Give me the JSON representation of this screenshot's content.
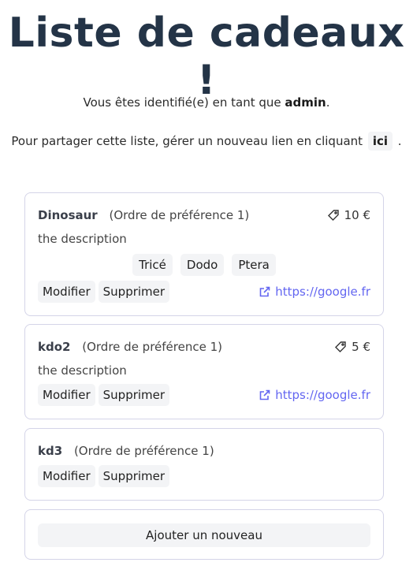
{
  "page": {
    "title": "Liste de cadeaux !",
    "identity_prefix": "Vous êtes identifié(e) en tant que",
    "username": "admin",
    "identity_suffix": ".",
    "share_prefix": "Pour partager cette liste, gérer un nouveau lien en cliquant",
    "share_link": "ici",
    "share_suffix": "."
  },
  "gifts": [
    {
      "name": "Dinosaur",
      "preference": "(Ordre de préférence 1)",
      "price": "10 €",
      "description": "the description",
      "tags": [
        "Tricé",
        "Dodo",
        "Ptera"
      ],
      "edit_label": "Modifier",
      "delete_label": "Supprimer",
      "link": "https://google.fr"
    },
    {
      "name": "kdo2",
      "preference": "(Ordre de préférence 1)",
      "price": "5 €",
      "description": "the description",
      "edit_label": "Modifier",
      "delete_label": "Supprimer",
      "link": "https://google.fr"
    },
    {
      "name": "kd3",
      "preference": "(Ordre de préférence 1)",
      "edit_label": "Modifier",
      "delete_label": "Supprimer"
    }
  ],
  "add_button": "Ajouter un nouveau",
  "colors": {
    "title": "#243447",
    "link": "#6366f1",
    "card_border": "#d4d4e8",
    "button_bg": "#f3f4f6"
  },
  "icons": {
    "price": "price-tag-icon",
    "link": "external-link-icon"
  }
}
